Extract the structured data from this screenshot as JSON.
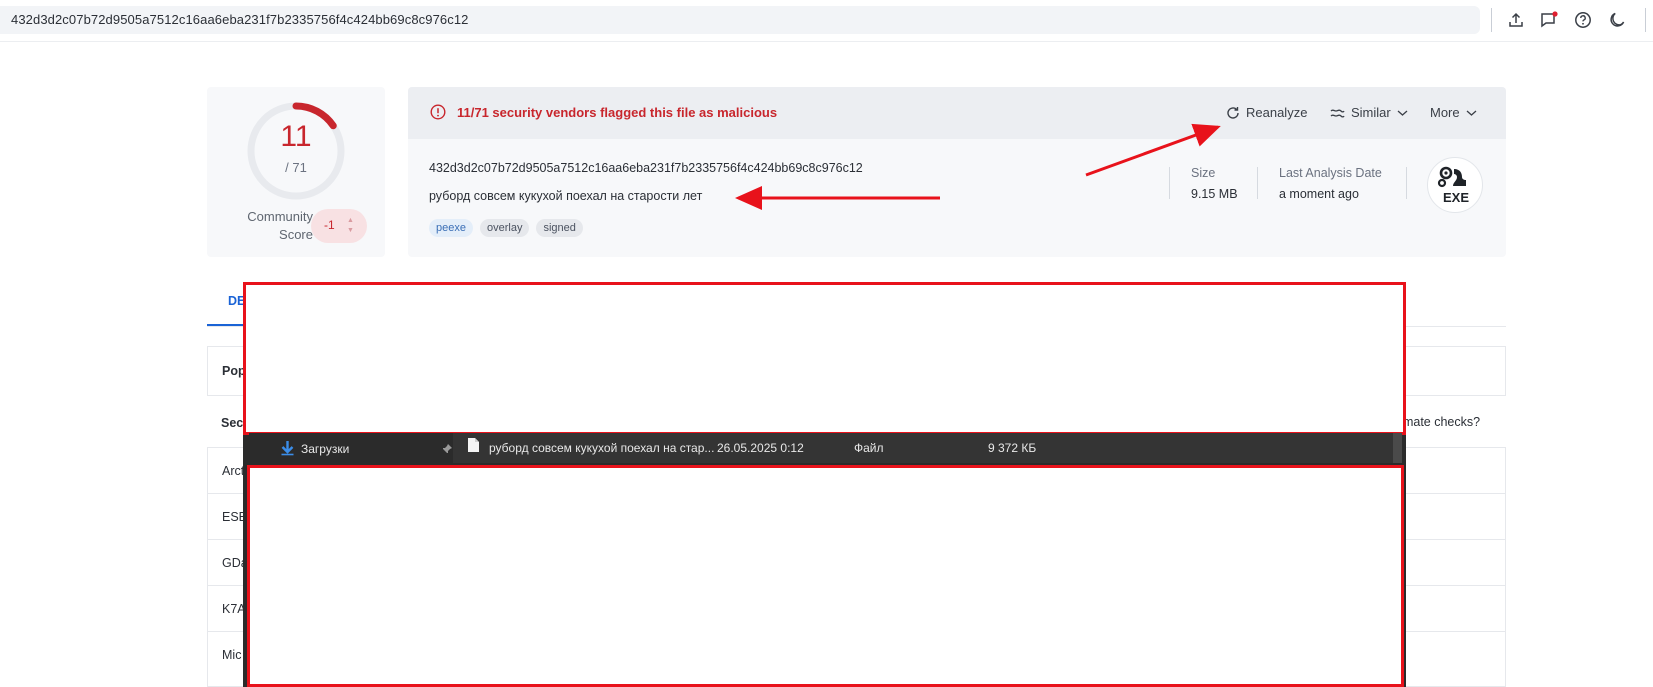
{
  "topbar": {
    "search_text": "432d3d2c07b72d9505a7512c16aa6eba231f7b2335756f4c424bb69c8c976c12",
    "icons": [
      "upload-icon",
      "comment-icon",
      "help-icon",
      "moon-icon"
    ]
  },
  "score": {
    "detections": "11",
    "total": "/ 71",
    "community_label_1": "Community",
    "community_label_2": "Score",
    "community_value": "-1",
    "fraction": 0.155
  },
  "alert": {
    "text": "11/71 security vendors flagged this file as malicious",
    "reanalyze": "Reanalyze",
    "similar": "Similar",
    "more": "More"
  },
  "file": {
    "hash": "432d3d2c07b72d9505a7512c16aa6eba231f7b2335756f4c424bb69c8c976c12",
    "name": "руборд совсем кукухой поехал на старости лет",
    "tags": [
      "peexe",
      "overlay",
      "signed"
    ],
    "size_label": "Size",
    "size_value": "9.15 MB",
    "date_label": "Last Analysis Date",
    "date_value": "a moment ago",
    "type_badge": "EXE"
  },
  "tabs": {
    "active": "DE"
  },
  "background_rows": {
    "pop": "Pop",
    "sec": "Sec",
    "automate": "omate checks?",
    "vendors": [
      "Arct",
      "ESE",
      "GDa",
      "K7A",
      "Mic"
    ]
  },
  "explorer": {
    "sidebar_item": "Загрузки",
    "file_name": "руборд совсем кукухой поехал на стар...",
    "file_date": "26.05.2025 0:12",
    "file_type": "Файл",
    "file_size": "9 372 КБ"
  },
  "colors": {
    "malicious": "#c8262d",
    "accent": "#1a63d6",
    "annotation": "#e8121b"
  }
}
